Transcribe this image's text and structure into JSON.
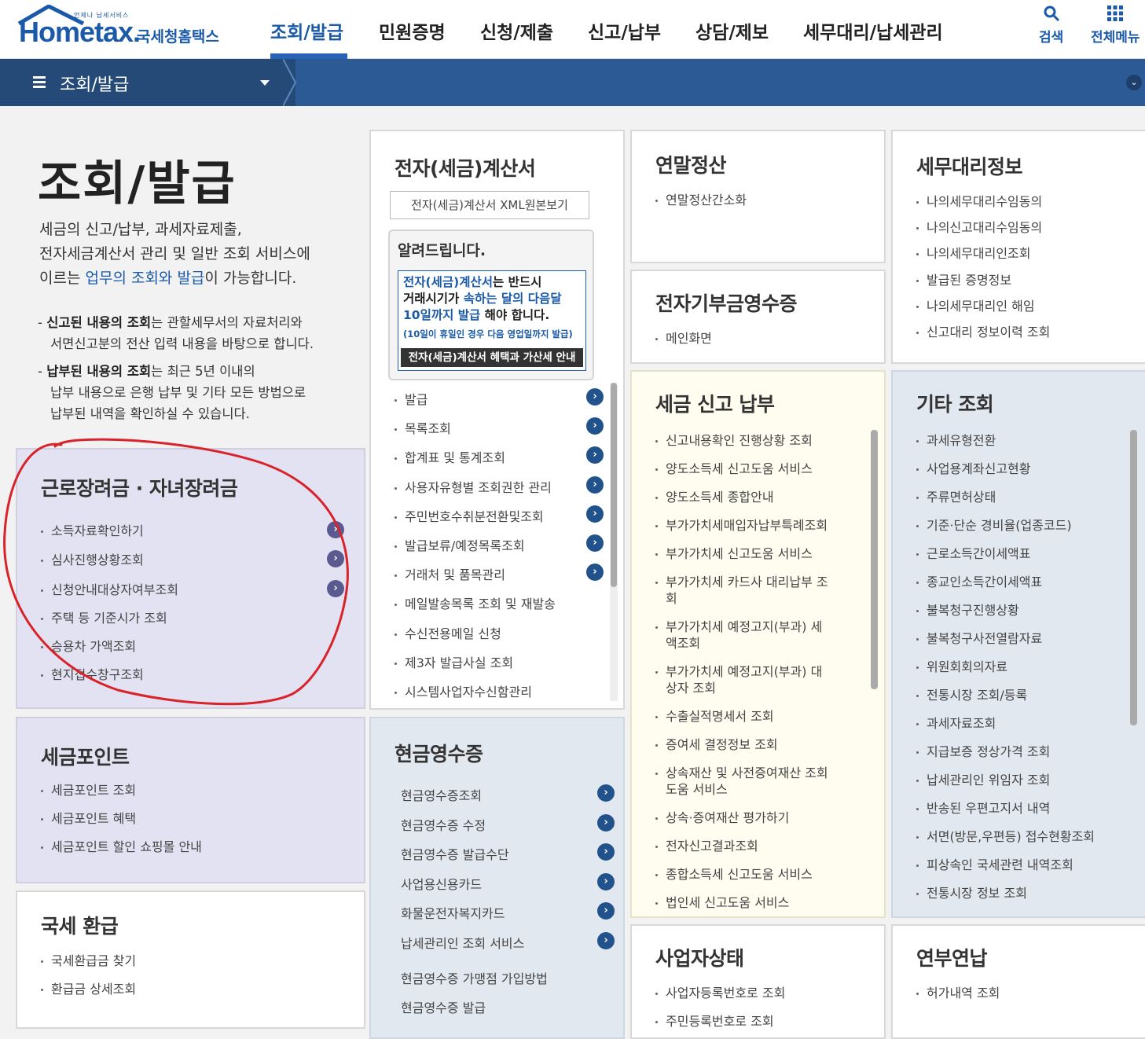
{
  "header": {
    "logo_small": "언제나 납세서비스",
    "logo_main": "Hometax.",
    "logo_kr": "국세청홈택스",
    "nav": [
      "조회/발급",
      "민원증명",
      "신청/제출",
      "신고/납부",
      "상담/제보",
      "세무대리/납세관리"
    ],
    "search_label": "검색",
    "all_menu_label": "전체메뉴"
  },
  "subbar": {
    "title": "조회/발급"
  },
  "intro": {
    "title": "조회/발급",
    "desc_1": "세금의 신고/납부, 과세자료제출,",
    "desc_2": "전자세금계산서 관리 및 일반 조회 서비스에",
    "desc_3a": "이르는 ",
    "desc_3b": "업무의 조회와 발급",
    "desc_3c": "이 가능합니다.",
    "note1_a": "- ",
    "note1_b": "신고된 내용의 조회",
    "note1_c": "는 관할세무서의 자료처리와",
    "note1_d": "서면신고분의 전산 입력 내용을 바탕으로 합니다.",
    "note2_a": "- ",
    "note2_b": "납부된 내용의 조회",
    "note2_c": "는 최근 5년 이내의",
    "note2_d": "납부 내용으로 은행 납부 및 기타 모든 방법으로",
    "note2_e": "납부된 내역을 확인하실 수 있습니다."
  },
  "panels": {
    "eitc": {
      "title": "근로장려금 · 자녀장려금",
      "items": [
        "소득자료확인하기",
        "심사진행상황조회",
        "신청안내대상자여부조회",
        "주택 등 기준시가 조회",
        "승용차 가액조회",
        "현지접수창구조회"
      ]
    },
    "point": {
      "title": "세금포인트",
      "items": [
        "세금포인트 조회",
        "세금포인트 혜택",
        "세금포인트 할인 쇼핑몰 안내"
      ]
    },
    "refund": {
      "title": "국세 환급",
      "items": [
        "국세환급금 찾기",
        "환급금 상세조회"
      ]
    },
    "einvoice": {
      "title": "전자(세금)계산서",
      "xml_button": "전자(세금)계산서 XML원본보기",
      "notice_title": "알려드립니다.",
      "notice_1a": "전자(세금)계산서",
      "notice_1b": "는 반드시",
      "notice_2a": "거래시기가 ",
      "notice_2b": "속하는 달의 다음달",
      "notice_3a": "10일까지 발급",
      "notice_3b": " 해야 합니다.",
      "notice_4": "(10일이 휴일인 경우 다음 영업일까지 발급)",
      "notice_bar": "전자(세금)계산서 혜택과 가산세 안내",
      "items": [
        "발급",
        "목록조회",
        "합계표 및 통계조회",
        "사용자유형별 조회권한 관리",
        "주민번호수취분전환및조회",
        "발급보류/예정목록조회",
        "거래처 및 품목관리",
        "메일발송목록 조회 및 재발송",
        "수신전용메일 신청",
        "제3자 발급사실 조회",
        "시스템사업자수신함관리"
      ]
    },
    "cash": {
      "title": "현금영수증",
      "items": [
        "현금영수증조회",
        "현금영수증 수정",
        "현금영수증 발급수단",
        "사업용신용카드",
        "화물운전자복지카드",
        "납세관리인 조회 서비스",
        "현금영수증 가맹점 가입방법",
        "현금영수증 발급"
      ]
    },
    "yearend": {
      "title": "연말정산",
      "items": [
        "연말정산간소화"
      ]
    },
    "donation": {
      "title": "전자기부금영수증",
      "items": [
        "메인화면"
      ]
    },
    "filing": {
      "title": "세금 신고 납부",
      "items": [
        "신고내용확인 진행상황 조회",
        "양도소득세 신고도움 서비스",
        "양도소득세 종합안내",
        "부가가치세매입자납부특례조회",
        "부가가치세 신고도움 서비스",
        "부가가치세 카드사 대리납부 조",
        "회",
        "부가가치세 예정고지(부과) 세",
        "액조회",
        "부가가치세 예정고지(부과) 대",
        "상자 조회",
        "수출실적명세서 조회",
        "증여세 결정정보 조회",
        "상속재산 및 사전증여재산 조회",
        "도움 서비스",
        "상속·증여재산 평가하기",
        "전자신고결과조회",
        "종합소득세 신고도움 서비스",
        "법인세 신고도움 서비스"
      ]
    },
    "bizstatus": {
      "title": "사업자상태",
      "items": [
        "사업자등록번호로 조회",
        "주민등록번호로 조회"
      ]
    },
    "agent": {
      "title": "세무대리정보",
      "items": [
        "나의세무대리수임동의",
        "나의신고대리수임동의",
        "나의세무대리인조회",
        "발급된 증명정보",
        "나의세무대리인 해임",
        "신고대리 정보이력 조회"
      ]
    },
    "other": {
      "title": "기타 조회",
      "items": [
        "과세유형전환",
        "사업용계좌신고현황",
        "주류면허상태",
        "기준·단순 경비율(업종코드)",
        "근로소득간이세액표",
        "종교인소득간이세액표",
        "불복청구진행상황",
        "불복청구사전열람자료",
        "위원회회의자료",
        "전통시장 조회/등록",
        "과세자료조회",
        "지급보증 정상가격 조회",
        "납세관리인 위임자 조회",
        "반송된 우편고지서 내역",
        "서면(방문,우편등) 접수현황조회",
        "피상속인 국세관련 내역조회",
        "전통시장 정보 조회"
      ]
    },
    "installment": {
      "title": "연부연납",
      "items": [
        "허가내역 조회"
      ]
    }
  },
  "colors": {
    "brand": "#1a5aa8",
    "subbar": "#2b5a95",
    "annotation": "#d9232a"
  }
}
